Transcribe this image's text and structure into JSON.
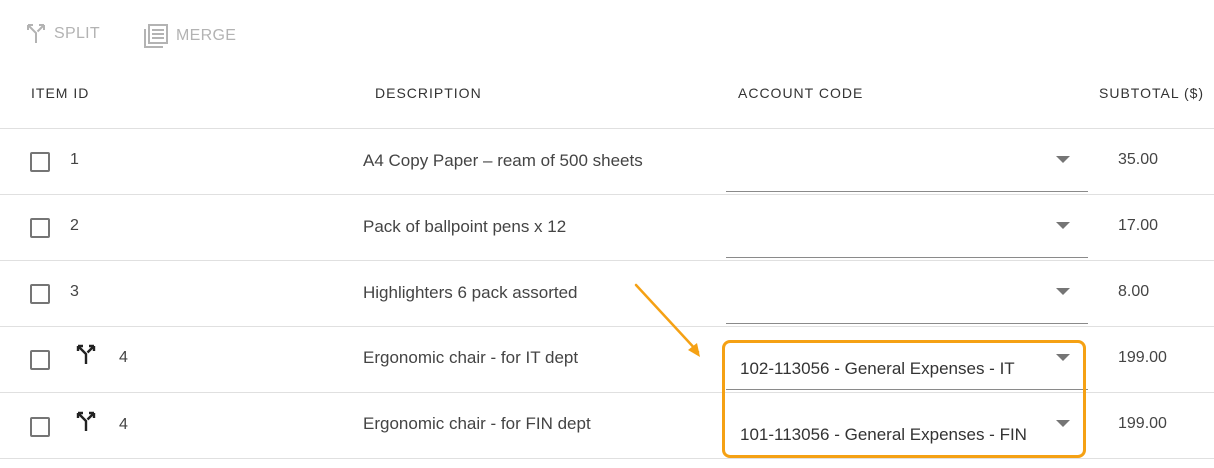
{
  "toolbar": {
    "split_label": "SPLIT",
    "merge_label": "MERGE"
  },
  "columns": {
    "item_id": "ITEM ID",
    "description": "DESCRIPTION",
    "account_code": "ACCOUNT CODE",
    "subtotal": "SUBTOTAL ($)"
  },
  "rows": [
    {
      "id": "1",
      "description": "A4 Copy Paper – ream of 500 sheets",
      "account": "",
      "subtotal": "35.00",
      "split": false
    },
    {
      "id": "2",
      "description": "Pack of ballpoint pens x 12",
      "account": "",
      "subtotal": "17.00",
      "split": false
    },
    {
      "id": "3",
      "description": "Highlighters 6 pack assorted",
      "account": "",
      "subtotal": "8.00",
      "split": false
    },
    {
      "id": "4",
      "description": "Ergonomic chair - for IT dept",
      "account": "102-113056 - General Expenses - IT",
      "subtotal": "199.00",
      "split": true
    },
    {
      "id": "4",
      "description": "Ergonomic chair - for FIN dept",
      "account": "101-113056 - General Expenses - FIN",
      "subtotal": "199.00",
      "split": true
    }
  ],
  "colors": {
    "highlight": "#f5a114",
    "disabled": "#b3b3b3"
  },
  "icons": {
    "split": "split-icon",
    "merge": "merge-icon"
  }
}
